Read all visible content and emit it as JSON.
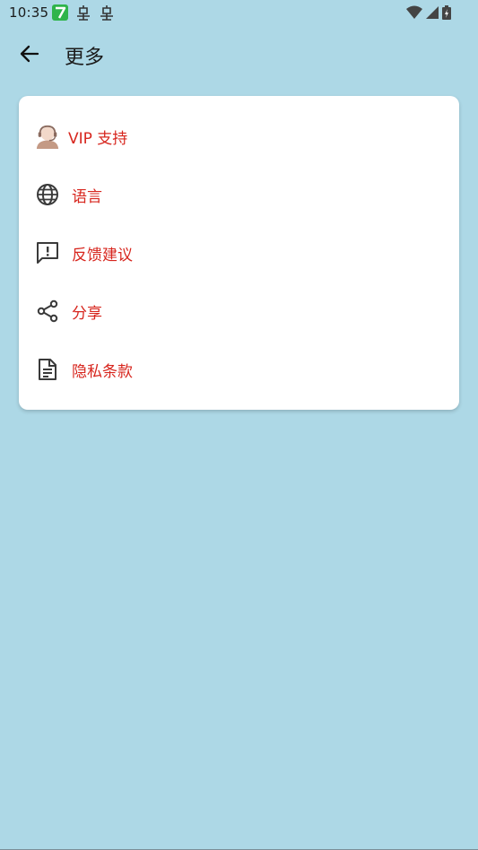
{
  "status_bar": {
    "time": "10:35",
    "icons": [
      "app-badge-icon",
      "bug-icon",
      "bug-icon",
      "wifi-icon",
      "signal-icon",
      "battery-icon"
    ]
  },
  "toolbar": {
    "title": "更多",
    "back_icon": "arrow-left-icon"
  },
  "menu": {
    "items": [
      {
        "label": "VIP 支持",
        "icon": "support-agent-icon"
      },
      {
        "label": "语言",
        "icon": "globe-icon"
      },
      {
        "label": "反馈建议",
        "icon": "feedback-icon"
      },
      {
        "label": "分享",
        "icon": "share-icon"
      },
      {
        "label": "隐私条款",
        "icon": "document-icon"
      }
    ]
  },
  "colors": {
    "background": "#ADD8E6",
    "label": "#D7261E",
    "card": "#FFFFFF"
  }
}
